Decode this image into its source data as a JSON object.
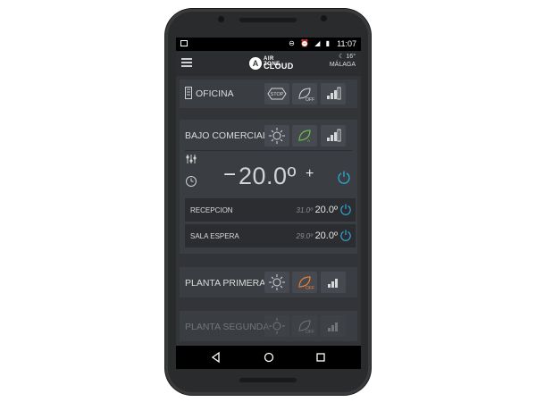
{
  "status_bar": {
    "time": "11:07",
    "icons": "⊖ ⏰ ◢ ▮"
  },
  "app": {
    "logo_brand_top": "AIR ZONE",
    "logo_brand_bottom": "CLOUD",
    "logo_mark": "A"
  },
  "weather": {
    "temperature": "16°",
    "city": "MÁLAGA"
  },
  "zones": [
    {
      "name": "OFICINA",
      "buttons": [
        "STOP",
        "OFF"
      ]
    },
    {
      "name": "BAJO COMERCIAL",
      "set_temp": "20.0º",
      "minus": "−",
      "plus": "+",
      "subzones": [
        {
          "name": "RECEPCION",
          "current": "31.0º",
          "set": "20.0º"
        },
        {
          "name": "SALA ESPERA",
          "current": "29.0º",
          "set": "20.0º"
        }
      ]
    },
    {
      "name": "PLANTA PRIMERA",
      "buttons": [
        "OFF"
      ]
    },
    {
      "name": "PLANTA SEGUNDA",
      "buttons": [
        "OFF"
      ]
    }
  ],
  "colors": {
    "accent_blue": "#2ea8d6",
    "accent_green": "#6cc04a",
    "accent_orange": "#e8823a",
    "screen_bg": "#323438"
  }
}
